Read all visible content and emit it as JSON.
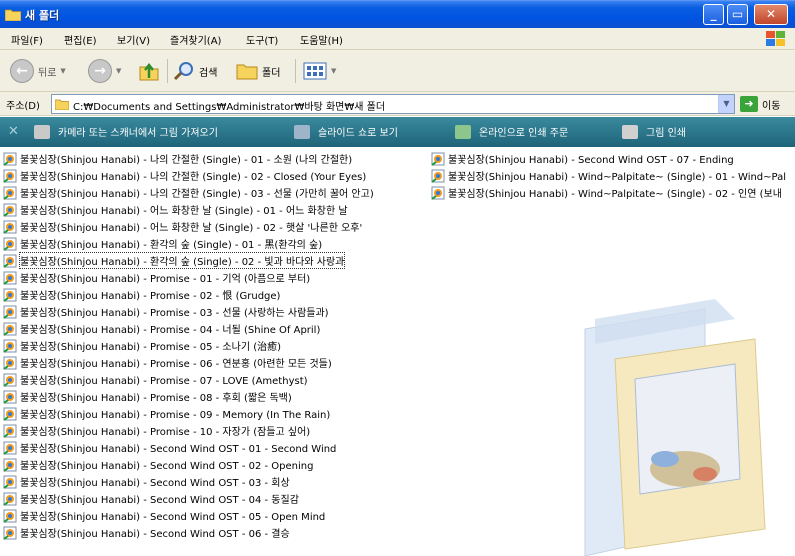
{
  "window": {
    "title": "새 폴더"
  },
  "menu": [
    "파일(F)",
    "편집(E)",
    "보기(V)",
    "즐겨찾기(A)",
    "도구(T)",
    "도움말(H)"
  ],
  "toolbar": {
    "back": "뒤로",
    "search": "검색",
    "folders": "폴더"
  },
  "address": {
    "label": "주소(D)",
    "path": "C:₩Documents and Settings₩Administrator₩바탕 화면₩새 폴더",
    "go": "이동"
  },
  "tasks": [
    "카메라 또는 스캐너에서 그림 가져오기",
    "슬라이드 쇼로 보기",
    "온라인으로 인쇄 주문",
    "그림 인쇄"
  ],
  "files_col1": [
    "불꽃심장(Shinjou Hanabi) - 나의 간절한 (Single) - 01 - 소원 (나의 간절한)",
    "불꽃심장(Shinjou Hanabi) - 나의 간절한 (Single) - 02 - Closed (Your Eyes)",
    "불꽃심장(Shinjou Hanabi) - 나의 간절한 (Single) - 03 - 선물 (가만히 꿀어 안고)",
    "불꽃심장(Shinjou Hanabi) - 어느 화창한 날 (Single) - 01 - 어느 화창한 날",
    "불꽃심장(Shinjou Hanabi) - 어느 화창한 날 (Single) - 02 - 햇살 '나른한 오후'",
    "불꽃심장(Shinjou Hanabi) - 환각의 숲 (Single) - 01 - 黑(환각의 숲)",
    "불꽃심장(Shinjou Hanabi) - 환각의 숲 (Single) - 02 - 빛과 바다와 사랑과",
    "불꽃심장(Shinjou Hanabi) - Promise - 01 - 기억 (아픔으로 부터)",
    "불꽃심장(Shinjou Hanabi) - Promise - 02 - 恨 (Grudge)",
    "불꽃심장(Shinjou Hanabi) - Promise - 03 - 선물 (사랑하는 사람들과)",
    "불꽃심장(Shinjou Hanabi) - Promise - 04 - 너될 (Shine Of April)",
    "불꽃심장(Shinjou Hanabi) - Promise - 05 - 소나기 (治癒)",
    "불꽃심장(Shinjou Hanabi) - Promise - 06 - 연분홍 (아련한 모든 것들)",
    "불꽃심장(Shinjou Hanabi) - Promise - 07 - LOVE (Amethyst)",
    "불꽃심장(Shinjou Hanabi) - Promise - 08 - 후회 (짧은 독백)",
    "불꽃심장(Shinjou Hanabi) - Promise - 09 - Memory (In The Rain)",
    "불꽃심장(Shinjou Hanabi) - Promise - 10 - 자장가 (잠들고 싶어)",
    "불꽃심장(Shinjou Hanabi) - Second Wind OST - 01 - Second Wind",
    "불꽃심장(Shinjou Hanabi) - Second Wind OST - 02 - Opening",
    "불꽃심장(Shinjou Hanabi) - Second Wind OST - 03 - 회상",
    "불꽃심장(Shinjou Hanabi) - Second Wind OST - 04 - 동질감",
    "불꽃심장(Shinjou Hanabi) - Second Wind OST - 05 - Open Mind",
    "불꽃심장(Shinjou Hanabi) - Second Wind OST - 06 - 결승"
  ],
  "files_col2": [
    "불꽃심장(Shinjou Hanabi) - Second Wind OST - 07 - Ending",
    "불꽃심장(Shinjou Hanabi) - Wind~Palpitate~ (Single) - 01 - Wind~Pal",
    "불꽃심장(Shinjou Hanabi) - Wind~Palpitate~ (Single) - 02 - 인연 (보내"
  ],
  "selected_index": 6
}
